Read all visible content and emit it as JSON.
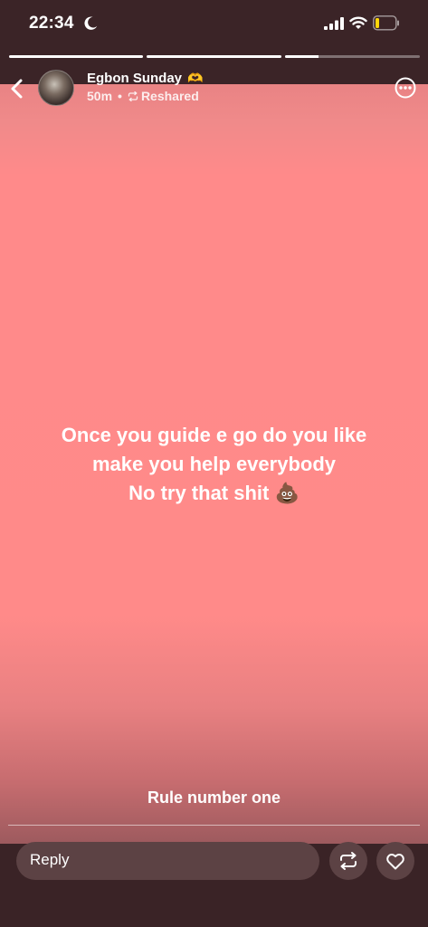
{
  "status_bar": {
    "time": "22:34"
  },
  "story_progress": {
    "segments": [
      1,
      1,
      0.25
    ]
  },
  "header": {
    "user_name": "Egbon Sunday",
    "name_emoji": "🫶",
    "age": "50m",
    "separator": "•",
    "reshared_label": "Reshared"
  },
  "story": {
    "text_lines": [
      "Once you guide e go do you like",
      "make you help everybody",
      "No try that shit 💩"
    ],
    "background_color": "#ff8a89"
  },
  "caption": "Rule number one",
  "footer": {
    "reply_placeholder": "Reply"
  }
}
